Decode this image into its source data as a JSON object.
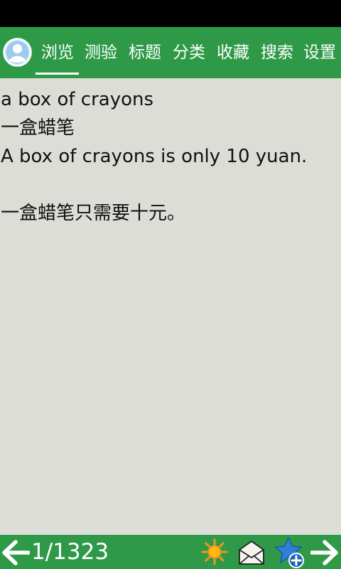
{
  "tabs": [
    {
      "label": "浏览"
    },
    {
      "label": "测验"
    },
    {
      "label": "标题"
    },
    {
      "label": "分类"
    },
    {
      "label": "收藏"
    },
    {
      "label": "搜索"
    },
    {
      "label": "设置"
    }
  ],
  "content": {
    "phrase": "a box of crayons",
    "phrase_translation": "一盒蜡笔",
    "example": "A box of crayons is only 10 yuan.",
    "example_translation": "一盒蜡笔只需要十元。"
  },
  "footer": {
    "page_counter": "1/1323"
  },
  "icons": {
    "avatar": "user-avatar-icon",
    "prev": "arrow-left-icon",
    "sun": "sun-icon",
    "mail": "mail-icon",
    "favorite": "star-add-icon",
    "next": "arrow-right-icon"
  },
  "colors": {
    "bar_green": "#2e9a48",
    "background": "#dcddd6",
    "status_bar": "#000000",
    "sun_orange": "#f7931e",
    "star_blue": "#2f7fd6"
  }
}
